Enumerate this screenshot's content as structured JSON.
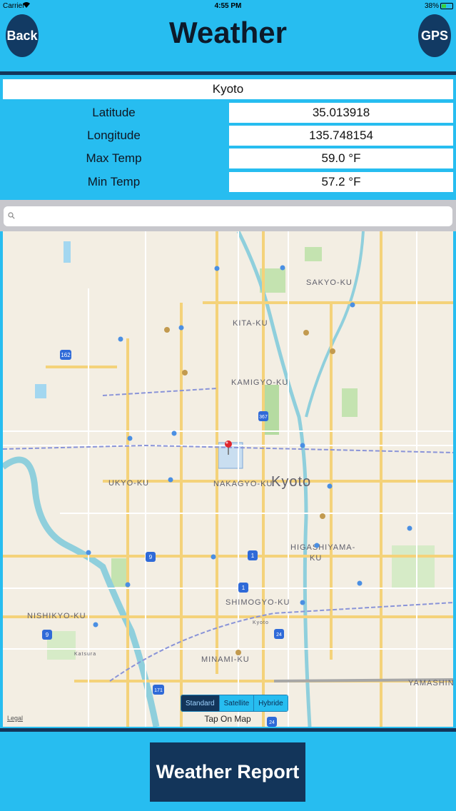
{
  "status_bar": {
    "carrier": "Carrier",
    "time": "4:55 PM",
    "battery": "38%"
  },
  "header": {
    "back_label": "Back",
    "title": "Weather",
    "gps_label": "GPS"
  },
  "city": "Kyoto",
  "rows": [
    {
      "label": "Latitude",
      "value": "35.013918"
    },
    {
      "label": "Longitude",
      "value": "135.748154"
    },
    {
      "label": "Max Temp",
      "value": "59.0 °F"
    },
    {
      "label": "Min Temp",
      "value": "57.2 °F"
    }
  ],
  "search": {
    "placeholder": ""
  },
  "map": {
    "labels": {
      "sakyo": "SAKYO-KU",
      "kita": "KITA-KU",
      "kamigyo": "KAMIGYO-KU",
      "ukyo": "UKYO-KU",
      "nakagyo": "NAKAGYO-KU",
      "kyoto": "Kyoto",
      "higashiyama": "HIGASHIYAMA-",
      "higashiyama2": "KU",
      "nishikyo": "NISHIKYO-KU",
      "shimogyo": "SHIMOGYO-KU",
      "minami": "MINAMI-KU",
      "yamashina": "YAMASHINA",
      "kyoto_station": "Kyoto",
      "katsura": "Katsura"
    },
    "route_shields": [
      "162",
      "367",
      "9",
      "1",
      "1",
      "24",
      "9",
      "171",
      "24"
    ],
    "type_options": [
      "Standard",
      "Satellite",
      "Hybride"
    ],
    "selected_type": "Standard",
    "hint": "Tap On Map",
    "legal": "Legal"
  },
  "footer": {
    "report_label": "Weather Report"
  },
  "colors": {
    "background": "#27bdf0",
    "dark": "#13355a",
    "pin": "#e0262d"
  }
}
